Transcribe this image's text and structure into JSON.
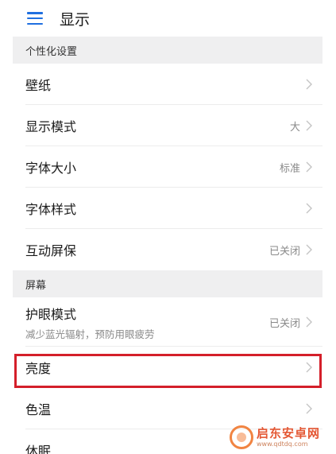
{
  "header": {
    "title": "显示",
    "menu_icon": "hamburger-menu-icon",
    "accent": "#1f6fe0"
  },
  "sections": {
    "personalization": {
      "title": "个性化设置",
      "rows": {
        "wallpaper": {
          "label": "壁纸",
          "value": ""
        },
        "display_mode": {
          "label": "显示模式",
          "value": "大"
        },
        "font_size": {
          "label": "字体大小",
          "value": "标准"
        },
        "font_style": {
          "label": "字体样式",
          "value": ""
        },
        "screensaver": {
          "label": "互动屏保",
          "value": "已关闭"
        }
      }
    },
    "screen": {
      "title": "屏幕",
      "rows": {
        "eye_comfort": {
          "label": "护眼模式",
          "sub": "减少蓝光辐射，预防用眼疲劳",
          "value": "已关闭"
        },
        "brightness": {
          "label": "亮度",
          "value": ""
        },
        "color_temp": {
          "label": "色温",
          "value": ""
        },
        "sleep": {
          "label": "休眠",
          "value": ""
        }
      }
    }
  },
  "highlight_color": "#d41f2a",
  "watermark": {
    "name": "启东安卓网",
    "url": "www.qdtdq.com"
  }
}
